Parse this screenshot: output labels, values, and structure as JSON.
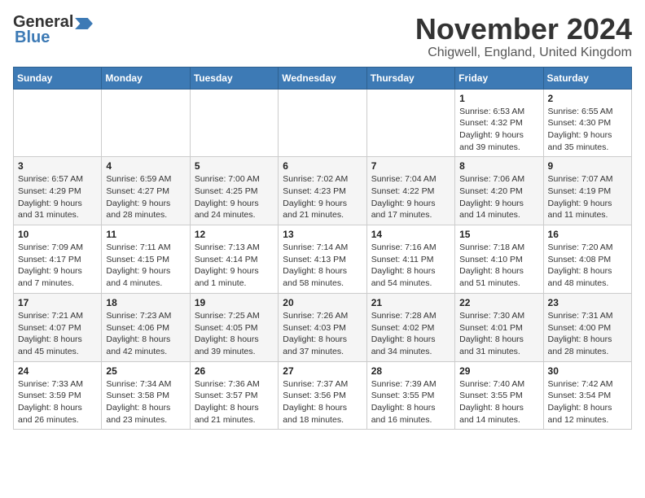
{
  "logo": {
    "line1": "General",
    "line2": "Blue"
  },
  "title": "November 2024",
  "location": "Chigwell, England, United Kingdom",
  "weekdays": [
    "Sunday",
    "Monday",
    "Tuesday",
    "Wednesday",
    "Thursday",
    "Friday",
    "Saturday"
  ],
  "weeks": [
    [
      {
        "day": "",
        "info": ""
      },
      {
        "day": "",
        "info": ""
      },
      {
        "day": "",
        "info": ""
      },
      {
        "day": "",
        "info": ""
      },
      {
        "day": "",
        "info": ""
      },
      {
        "day": "1",
        "info": "Sunrise: 6:53 AM\nSunset: 4:32 PM\nDaylight: 9 hours\nand 39 minutes."
      },
      {
        "day": "2",
        "info": "Sunrise: 6:55 AM\nSunset: 4:30 PM\nDaylight: 9 hours\nand 35 minutes."
      }
    ],
    [
      {
        "day": "3",
        "info": "Sunrise: 6:57 AM\nSunset: 4:29 PM\nDaylight: 9 hours\nand 31 minutes."
      },
      {
        "day": "4",
        "info": "Sunrise: 6:59 AM\nSunset: 4:27 PM\nDaylight: 9 hours\nand 28 minutes."
      },
      {
        "day": "5",
        "info": "Sunrise: 7:00 AM\nSunset: 4:25 PM\nDaylight: 9 hours\nand 24 minutes."
      },
      {
        "day": "6",
        "info": "Sunrise: 7:02 AM\nSunset: 4:23 PM\nDaylight: 9 hours\nand 21 minutes."
      },
      {
        "day": "7",
        "info": "Sunrise: 7:04 AM\nSunset: 4:22 PM\nDaylight: 9 hours\nand 17 minutes."
      },
      {
        "day": "8",
        "info": "Sunrise: 7:06 AM\nSunset: 4:20 PM\nDaylight: 9 hours\nand 14 minutes."
      },
      {
        "day": "9",
        "info": "Sunrise: 7:07 AM\nSunset: 4:19 PM\nDaylight: 9 hours\nand 11 minutes."
      }
    ],
    [
      {
        "day": "10",
        "info": "Sunrise: 7:09 AM\nSunset: 4:17 PM\nDaylight: 9 hours\nand 7 minutes."
      },
      {
        "day": "11",
        "info": "Sunrise: 7:11 AM\nSunset: 4:15 PM\nDaylight: 9 hours\nand 4 minutes."
      },
      {
        "day": "12",
        "info": "Sunrise: 7:13 AM\nSunset: 4:14 PM\nDaylight: 9 hours\nand 1 minute."
      },
      {
        "day": "13",
        "info": "Sunrise: 7:14 AM\nSunset: 4:13 PM\nDaylight: 8 hours\nand 58 minutes."
      },
      {
        "day": "14",
        "info": "Sunrise: 7:16 AM\nSunset: 4:11 PM\nDaylight: 8 hours\nand 54 minutes."
      },
      {
        "day": "15",
        "info": "Sunrise: 7:18 AM\nSunset: 4:10 PM\nDaylight: 8 hours\nand 51 minutes."
      },
      {
        "day": "16",
        "info": "Sunrise: 7:20 AM\nSunset: 4:08 PM\nDaylight: 8 hours\nand 48 minutes."
      }
    ],
    [
      {
        "day": "17",
        "info": "Sunrise: 7:21 AM\nSunset: 4:07 PM\nDaylight: 8 hours\nand 45 minutes."
      },
      {
        "day": "18",
        "info": "Sunrise: 7:23 AM\nSunset: 4:06 PM\nDaylight: 8 hours\nand 42 minutes."
      },
      {
        "day": "19",
        "info": "Sunrise: 7:25 AM\nSunset: 4:05 PM\nDaylight: 8 hours\nand 39 minutes."
      },
      {
        "day": "20",
        "info": "Sunrise: 7:26 AM\nSunset: 4:03 PM\nDaylight: 8 hours\nand 37 minutes."
      },
      {
        "day": "21",
        "info": "Sunrise: 7:28 AM\nSunset: 4:02 PM\nDaylight: 8 hours\nand 34 minutes."
      },
      {
        "day": "22",
        "info": "Sunrise: 7:30 AM\nSunset: 4:01 PM\nDaylight: 8 hours\nand 31 minutes."
      },
      {
        "day": "23",
        "info": "Sunrise: 7:31 AM\nSunset: 4:00 PM\nDaylight: 8 hours\nand 28 minutes."
      }
    ],
    [
      {
        "day": "24",
        "info": "Sunrise: 7:33 AM\nSunset: 3:59 PM\nDaylight: 8 hours\nand 26 minutes."
      },
      {
        "day": "25",
        "info": "Sunrise: 7:34 AM\nSunset: 3:58 PM\nDaylight: 8 hours\nand 23 minutes."
      },
      {
        "day": "26",
        "info": "Sunrise: 7:36 AM\nSunset: 3:57 PM\nDaylight: 8 hours\nand 21 minutes."
      },
      {
        "day": "27",
        "info": "Sunrise: 7:37 AM\nSunset: 3:56 PM\nDaylight: 8 hours\nand 18 minutes."
      },
      {
        "day": "28",
        "info": "Sunrise: 7:39 AM\nSunset: 3:55 PM\nDaylight: 8 hours\nand 16 minutes."
      },
      {
        "day": "29",
        "info": "Sunrise: 7:40 AM\nSunset: 3:55 PM\nDaylight: 8 hours\nand 14 minutes."
      },
      {
        "day": "30",
        "info": "Sunrise: 7:42 AM\nSunset: 3:54 PM\nDaylight: 8 hours\nand 12 minutes."
      }
    ]
  ]
}
